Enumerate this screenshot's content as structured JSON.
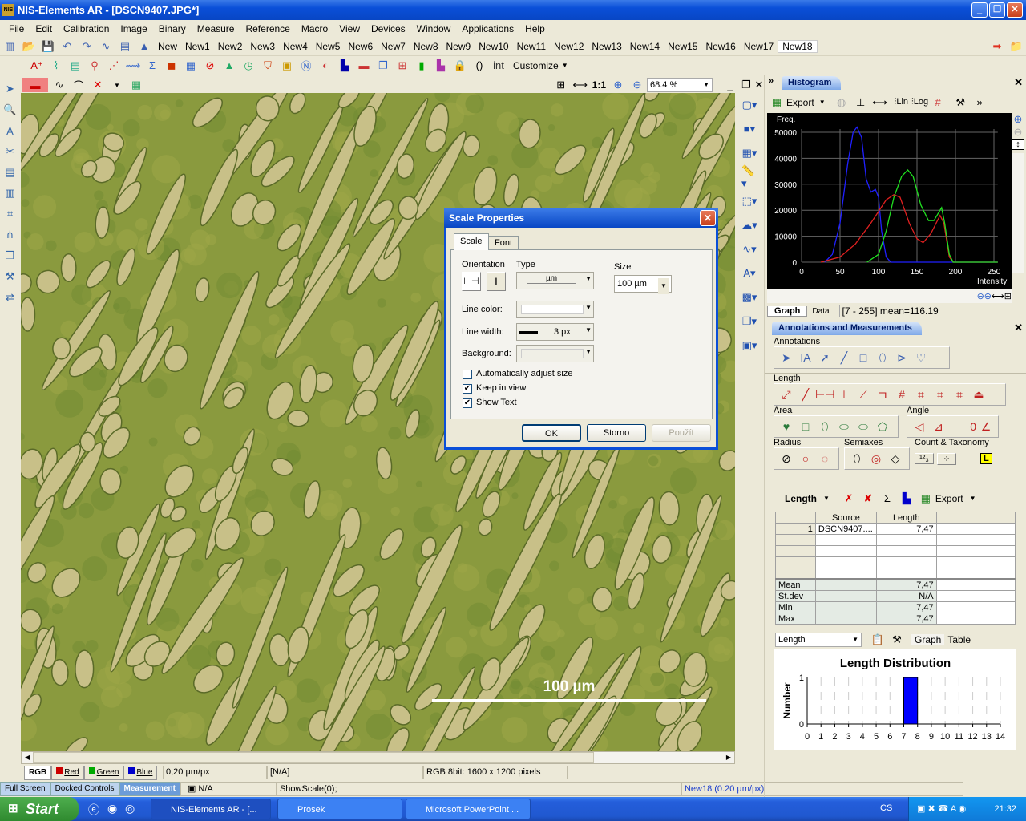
{
  "app": {
    "title": "NIS-Elements AR  - [DSCN9407.JPG*]",
    "window_buttons": [
      "_",
      "❐",
      "✕"
    ]
  },
  "menu": [
    "File",
    "Edit",
    "Calibration",
    "Image",
    "Binary",
    "Measure",
    "Reference",
    "Macro",
    "View",
    "Devices",
    "Window",
    "Applications",
    "Help"
  ],
  "toolbar1": {
    "icons": [
      "channels-icon",
      "open-icon",
      "save-icon",
      "undo-icon",
      "redo-icon",
      "macro-icon",
      "copy-icon",
      "stamp-icon"
    ],
    "new_tabs": [
      "New",
      "New1",
      "New2",
      "New3",
      "New4",
      "New5",
      "New6",
      "New7",
      "New8",
      "New9",
      "New10",
      "New11",
      "New12",
      "New13",
      "New14",
      "New15",
      "New16",
      "New17",
      "New18"
    ],
    "active_tab": "New18"
  },
  "toolbar2": {
    "icons": [
      "annotation-text-icon",
      "measure-icon",
      "object-data-icon",
      "probe-icon",
      "scatter-icon",
      "profile-icon",
      "sum-icon",
      "color-icon",
      "table-icon",
      "stop-icon",
      "histogram-icon",
      "timer-icon",
      "shield-icon",
      "folder-icon",
      "nd-icon",
      "overlay-icon",
      "histogram-view-icon",
      "lut-icon",
      "layers-icon",
      "crosshair-icon",
      "spectrum-icon",
      "graph-icon",
      "lock-icon",
      "braces-icon",
      "int-icon"
    ],
    "customize": "Customize"
  },
  "image_toolbar": {
    "zoom_value": "68.4 %",
    "one_to_one": "1:1"
  },
  "image": {
    "scale_bar_text": "100 µm"
  },
  "channels": [
    {
      "label": "RGB",
      "color": ""
    },
    {
      "label": "Red",
      "color": "#cc0000"
    },
    {
      "label": "Green",
      "color": "#00aa00"
    },
    {
      "label": "Blue",
      "color": "#0000cc"
    }
  ],
  "status": {
    "calibration": "0,20 µm/px",
    "value": "[N/A]",
    "image_info": "RGB 8bit: 1600 x 1200 pixels"
  },
  "bottom": {
    "tabs": [
      "Full Screen",
      "Docked Controls",
      "Measurement"
    ],
    "active": "Measurement",
    "na": "N/A",
    "command": "ShowScale(0);",
    "doc": "New18 (0.20 µm/px)"
  },
  "taskbar": {
    "start": "Start",
    "tasks": [
      "NIS-Elements AR - [...",
      "Prosek",
      "Microsoft PowerPoint ..."
    ],
    "lang": "CS",
    "clock": "21:32"
  },
  "histogram": {
    "title": "Histogram",
    "export": "Export",
    "lin": "Lin",
    "log": "Log",
    "tabs": [
      "Graph",
      "Data"
    ],
    "range_info": "[7 - 255]   mean=116.19"
  },
  "chart_data": [
    {
      "type": "line",
      "ylabel": "Freq.",
      "xlabel": "Intensity",
      "xlim": [
        0,
        255
      ],
      "ylim": [
        0,
        50000
      ],
      "xticks": [
        0,
        50,
        100,
        150,
        200,
        250
      ],
      "yticks": [
        0,
        10000,
        20000,
        30000,
        40000,
        50000
      ],
      "grid": true,
      "series": [
        {
          "color": "#2020ff",
          "points": [
            [
              30,
              0
            ],
            [
              40,
              3000
            ],
            [
              50,
              15000
            ],
            [
              60,
              38000
            ],
            [
              67,
              50000
            ],
            [
              72,
              52000
            ],
            [
              78,
              48000
            ],
            [
              84,
              32000
            ],
            [
              90,
              27000
            ],
            [
              96,
              28000
            ],
            [
              100,
              25000
            ],
            [
              104,
              12000
            ],
            [
              110,
              2000
            ],
            [
              116,
              0
            ],
            [
              255,
              0
            ]
          ]
        },
        {
          "color": "#e02020",
          "points": [
            [
              25,
              0
            ],
            [
              50,
              2000
            ],
            [
              70,
              7000
            ],
            [
              90,
              15000
            ],
            [
              110,
              24000
            ],
            [
              120,
              26000
            ],
            [
              128,
              25000
            ],
            [
              140,
              15000
            ],
            [
              150,
              9000
            ],
            [
              158,
              7500
            ],
            [
              168,
              11000
            ],
            [
              180,
              18000
            ],
            [
              185,
              15000
            ],
            [
              192,
              2000
            ],
            [
              197,
              0
            ],
            [
              255,
              0
            ]
          ]
        },
        {
          "color": "#20e020",
          "points": [
            [
              85,
              0
            ],
            [
              100,
              3000
            ],
            [
              110,
              12000
            ],
            [
              120,
              25000
            ],
            [
              130,
              33000
            ],
            [
              138,
              35500
            ],
            [
              145,
              33000
            ],
            [
              155,
              22000
            ],
            [
              165,
              16000
            ],
            [
              172,
              16000
            ],
            [
              178,
              19000
            ],
            [
              182,
              21000
            ],
            [
              186,
              15000
            ],
            [
              192,
              3000
            ],
            [
              197,
              0
            ],
            [
              255,
              0
            ]
          ]
        }
      ]
    },
    {
      "type": "bar",
      "title": "Length Distribution",
      "ylabel": "Number",
      "xlim": [
        0,
        14
      ],
      "ylim": [
        0,
        1
      ],
      "xticks": [
        0,
        1,
        2,
        3,
        4,
        5,
        6,
        7,
        8,
        9,
        10,
        11,
        12,
        13,
        14
      ],
      "yticks": [
        0,
        1
      ],
      "bins": [
        {
          "from": 7,
          "to": 8,
          "value": 1
        }
      ],
      "color": "#0000ff"
    }
  ],
  "annotations": {
    "title": "Annotations and Measurements",
    "groups": {
      "annotations": "Annotations",
      "length": "Length",
      "area": "Area",
      "angle": "Angle",
      "radius": "Radius",
      "semiaxes": "Semiaxes",
      "count": "Count & Taxonomy"
    },
    "angle_value": "0",
    "taxonomy_badge": "L"
  },
  "measurements": {
    "feature": "Length",
    "export": "Export",
    "columns": [
      "",
      "Source",
      "Length",
      ""
    ],
    "rows": [
      {
        "n": "1",
        "source": "DSCN9407....",
        "length": "7,47"
      }
    ],
    "stats": [
      {
        "label": "Mean",
        "value": "7,47"
      },
      {
        "label": "St.dev",
        "value": "N/A"
      },
      {
        "label": "Min",
        "value": "7,47"
      },
      {
        "label": "Max",
        "value": "7,47"
      }
    ],
    "graph_feature": "Length",
    "view_tabs": [
      "Graph",
      "Table"
    ]
  },
  "dialog": {
    "title": "Scale Properties",
    "tabs": [
      "Scale",
      "Font"
    ],
    "orientation_label": "Orientation",
    "type_label": "Type",
    "type_value": "µm",
    "size_label": "Size",
    "size_value": "100 µm",
    "line_color_label": "Line color:",
    "line_width_label": "Line width:",
    "line_width_value": "3 px",
    "background_label": "Background:",
    "checkboxes": [
      {
        "label": "Automatically adjust size",
        "checked": false
      },
      {
        "label": "Keep in view",
        "checked": true
      },
      {
        "label": "Show Text",
        "checked": true
      }
    ],
    "ok": "OK",
    "cancel": "Storno",
    "apply": "Použít"
  }
}
